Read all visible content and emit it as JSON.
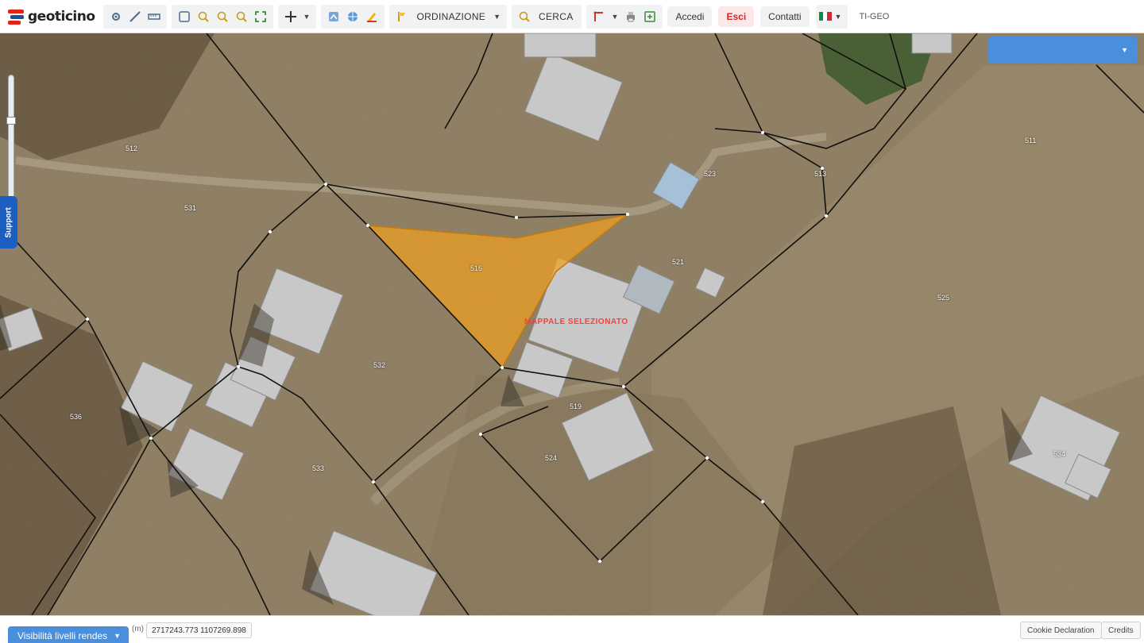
{
  "app": {
    "logo_text": "geoticino",
    "colors": {
      "accent": "#4a8fdc",
      "brand_red": "#e2231a",
      "brand_blue": "#1f4e9c",
      "selection": "#f0a020",
      "support": "#1d5fc0"
    }
  },
  "toolbar": {
    "ordinazione_label": "ORDINAZIONE",
    "cerca_label": "CERCA",
    "accedi_label": "Accedi",
    "esci_label": "Esci",
    "contatti_label": "Contatti",
    "tigeo_label": "TI-GEO"
  },
  "map": {
    "support_label": "Support",
    "parcel_labels": [
      "512",
      "513",
      "516",
      "521",
      "525",
      "532",
      "536",
      "533",
      "524",
      "519",
      "523",
      "534",
      "531",
      "511"
    ],
    "selected_parcel_label": "516",
    "selected_feature_text": "MAPPALE SELEZIONATO"
  },
  "bottombar": {
    "layers_button_label": "Visibilità livelli rendes",
    "coords_prefix": "(m)",
    "coordinates": "2717243.773 1107269.898",
    "cookie_label": "Cookie Declaration",
    "credits_label": "Credits"
  }
}
